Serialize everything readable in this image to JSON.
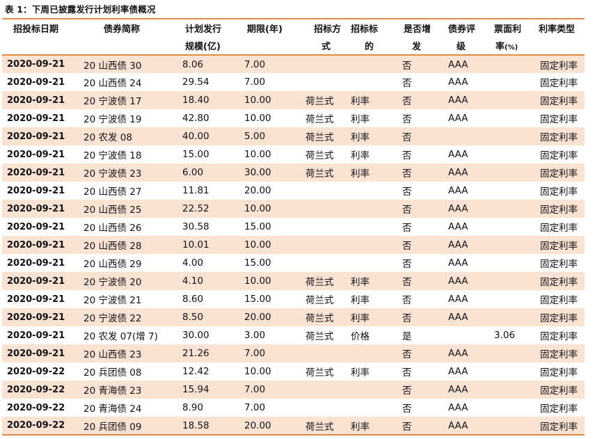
{
  "caption": "表 1：下周已披露发行计划利率债概况",
  "headers": {
    "date": "招投标日期",
    "name": "债券简称",
    "scale_1": "计划发行",
    "scale_2": "规模(亿)",
    "term": "期限(年)",
    "method_1": "招标方",
    "method_2": "式",
    "target_1": "招标标",
    "target_2": "的",
    "add_1": "是否增",
    "add_2": "发",
    "rating_1": "债券评",
    "rating_2": "级",
    "coupon_1": "票面利",
    "coupon_2": "率",
    "coupon_unit": "(%)",
    "type": "利率类型"
  },
  "rows": [
    {
      "date": "2020-09-21",
      "name": "20 山西债 30",
      "scale": "8.06",
      "term": "7.00",
      "method": "",
      "target": "",
      "add": "否",
      "rating": "AAA",
      "coupon": "",
      "type": "固定利率"
    },
    {
      "date": "2020-09-21",
      "name": "20 山西债 24",
      "scale": "29.54",
      "term": "7.00",
      "method": "",
      "target": "",
      "add": "否",
      "rating": "AAA",
      "coupon": "",
      "type": "固定利率"
    },
    {
      "date": "2020-09-21",
      "name": "20 宁波债 17",
      "scale": "18.40",
      "term": "10.00",
      "method": "荷兰式",
      "target": "利率",
      "add": "否",
      "rating": "AAA",
      "coupon": "",
      "type": "固定利率"
    },
    {
      "date": "2020-09-21",
      "name": "20 宁波债 19",
      "scale": "42.80",
      "term": "10.00",
      "method": "荷兰式",
      "target": "利率",
      "add": "否",
      "rating": "AAA",
      "coupon": "",
      "type": "固定利率"
    },
    {
      "date": "2020-09-21",
      "name": "20 农发 08",
      "scale": "40.00",
      "term": "5.00",
      "method": "荷兰式",
      "target": "利率",
      "add": "否",
      "rating": "",
      "coupon": "",
      "type": "固定利率"
    },
    {
      "date": "2020-09-21",
      "name": "20 宁波债 18",
      "scale": "15.00",
      "term": "10.00",
      "method": "荷兰式",
      "target": "利率",
      "add": "否",
      "rating": "AAA",
      "coupon": "",
      "type": "固定利率"
    },
    {
      "date": "2020-09-21",
      "name": "20 宁波债 23",
      "scale": "6.00",
      "term": "30.00",
      "method": "荷兰式",
      "target": "利率",
      "add": "否",
      "rating": "AAA",
      "coupon": "",
      "type": "固定利率"
    },
    {
      "date": "2020-09-21",
      "name": "20 山西债 27",
      "scale": "11.81",
      "term": "20.00",
      "method": "",
      "target": "",
      "add": "否",
      "rating": "AAA",
      "coupon": "",
      "type": "固定利率"
    },
    {
      "date": "2020-09-21",
      "name": "20 山西债 25",
      "scale": "22.52",
      "term": "10.00",
      "method": "",
      "target": "",
      "add": "否",
      "rating": "AAA",
      "coupon": "",
      "type": "固定利率"
    },
    {
      "date": "2020-09-21",
      "name": "20 山西债 26",
      "scale": "30.58",
      "term": "15.00",
      "method": "",
      "target": "",
      "add": "否",
      "rating": "AAA",
      "coupon": "",
      "type": "固定利率"
    },
    {
      "date": "2020-09-21",
      "name": "20 山西债 28",
      "scale": "10.01",
      "term": "10.00",
      "method": "",
      "target": "",
      "add": "否",
      "rating": "AAA",
      "coupon": "",
      "type": "固定利率"
    },
    {
      "date": "2020-09-21",
      "name": "20 山西债 29",
      "scale": "4.00",
      "term": "15.00",
      "method": "",
      "target": "",
      "add": "否",
      "rating": "AAA",
      "coupon": "",
      "type": "固定利率"
    },
    {
      "date": "2020-09-21",
      "name": "20 宁波债 20",
      "scale": "4.10",
      "term": "10.00",
      "method": "荷兰式",
      "target": "利率",
      "add": "否",
      "rating": "AAA",
      "coupon": "",
      "type": "固定利率"
    },
    {
      "date": "2020-09-21",
      "name": "20 宁波债 21",
      "scale": "8.60",
      "term": "15.00",
      "method": "荷兰式",
      "target": "利率",
      "add": "否",
      "rating": "AAA",
      "coupon": "",
      "type": "固定利率"
    },
    {
      "date": "2020-09-21",
      "name": "20 宁波债 22",
      "scale": "8.50",
      "term": "20.00",
      "method": "荷兰式",
      "target": "利率",
      "add": "否",
      "rating": "AAA",
      "coupon": "",
      "type": "固定利率"
    },
    {
      "date": "2020-09-21",
      "name": "20 农发 07(增 7)",
      "scale": "30.00",
      "term": "3.00",
      "method": "荷兰式",
      "target": "价格",
      "add": "是",
      "rating": "",
      "coupon": "3.06",
      "type": "固定利率"
    },
    {
      "date": "2020-09-21",
      "name": "20 山西债 23",
      "scale": "21.26",
      "term": "7.00",
      "method": "",
      "target": "",
      "add": "否",
      "rating": "AAA",
      "coupon": "",
      "type": "固定利率"
    },
    {
      "date": "2020-09-22",
      "name": "20 兵团债 08",
      "scale": "12.42",
      "term": "10.00",
      "method": "荷兰式",
      "target": "利率",
      "add": "否",
      "rating": "AAA",
      "coupon": "",
      "type": "固定利率"
    },
    {
      "date": "2020-09-22",
      "name": "20 青海债 23",
      "scale": "15.94",
      "term": "7.00",
      "method": "",
      "target": "",
      "add": "否",
      "rating": "AAA",
      "coupon": "",
      "type": "固定利率"
    },
    {
      "date": "2020-09-22",
      "name": "20 青海债 24",
      "scale": "8.90",
      "term": "7.00",
      "method": "",
      "target": "",
      "add": "否",
      "rating": "AAA",
      "coupon": "",
      "type": "固定利率"
    },
    {
      "date": "2020-09-22",
      "name": "20 兵团债 09",
      "scale": "18.58",
      "term": "20.00",
      "method": "荷兰式",
      "target": "利率",
      "add": "否",
      "rating": "AAA",
      "coupon": "",
      "type": "固定利率"
    }
  ]
}
